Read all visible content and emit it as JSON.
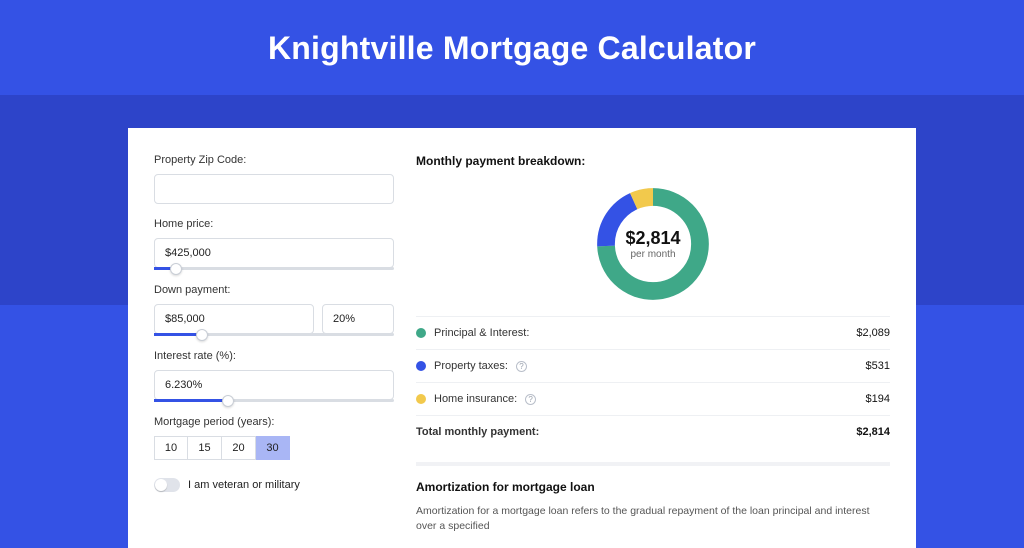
{
  "title": "Knightville Mortgage Calculator",
  "form": {
    "zip_label": "Property Zip Code:",
    "zip_value": "",
    "home_price_label": "Home price:",
    "home_price_value": "$425,000",
    "home_price_slider": {
      "percent": 9
    },
    "down_payment_label": "Down payment:",
    "down_payment_value": "$85,000",
    "down_payment_pct": "20%",
    "down_payment_slider": {
      "percent": 20
    },
    "rate_label": "Interest rate (%):",
    "rate_value": "6.230%",
    "rate_slider": {
      "percent": 31
    },
    "period_label": "Mortgage period (years):",
    "period_options": [
      "10",
      "15",
      "20",
      "30"
    ],
    "period_active_index": 3,
    "veteran_label": "I am veteran or military",
    "veteran_on": false
  },
  "breakdown": {
    "title": "Monthly payment breakdown:",
    "center_value": "$2,814",
    "center_sub": "per month",
    "items": [
      {
        "label": "Principal & Interest:",
        "value": "$2,089",
        "color": "#3fa888",
        "info": false
      },
      {
        "label": "Property taxes:",
        "value": "$531",
        "color": "#3452e5",
        "info": true
      },
      {
        "label": "Home insurance:",
        "value": "$194",
        "color": "#f2c94c",
        "info": true
      }
    ],
    "total_label": "Total monthly payment:",
    "total_value": "$2,814"
  },
  "chart_data": {
    "type": "pie",
    "title": "Monthly payment breakdown",
    "series": [
      {
        "name": "Principal & Interest",
        "value": 2089,
        "color": "#3fa888"
      },
      {
        "name": "Property taxes",
        "value": 531,
        "color": "#3452e5"
      },
      {
        "name": "Home insurance",
        "value": 194,
        "color": "#f2c94c"
      }
    ],
    "total": 2814
  },
  "amort": {
    "title": "Amortization for mortgage loan",
    "text": "Amortization for a mortgage loan refers to the gradual repayment of the loan principal and interest over a specified"
  }
}
